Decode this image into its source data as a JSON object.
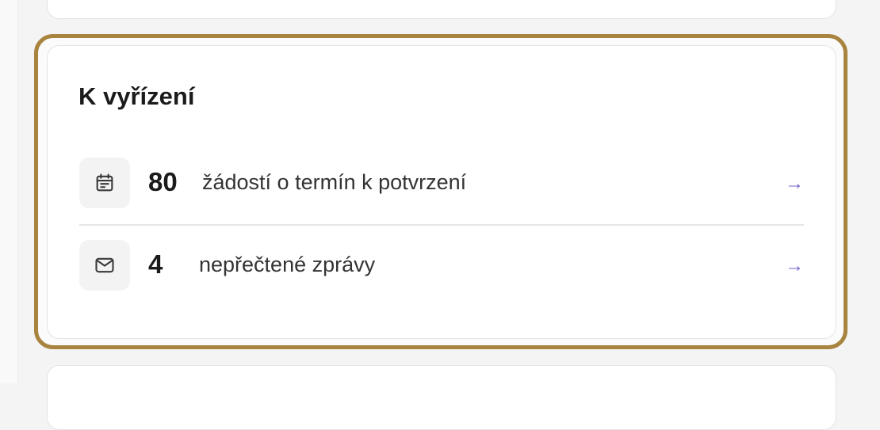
{
  "panel": {
    "title": "K vyřízení",
    "items": [
      {
        "icon": "calendar-icon",
        "count": "80",
        "label": "žádostí o termín k potvrzení",
        "arrow": "→"
      },
      {
        "icon": "mail-icon",
        "count": "4",
        "label": "nepřečtené zprávy",
        "arrow": "→"
      }
    ]
  },
  "colors": {
    "highlight_border": "#a8843f",
    "arrow": "#6f63c8",
    "icon_bg": "#f3f3f3"
  }
}
